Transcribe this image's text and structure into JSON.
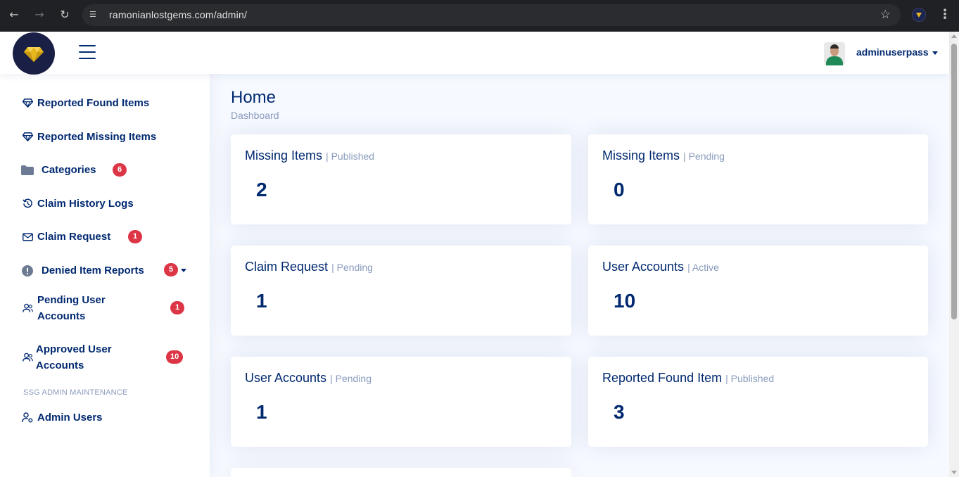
{
  "browser": {
    "url": "ramonianlostgems.com/admin/"
  },
  "header": {
    "user_name": "adminuserpass"
  },
  "sidebar": {
    "items": [
      {
        "label": "Reported Found Items",
        "icon": "gem-icon"
      },
      {
        "label": "Reported Missing Items",
        "icon": "gem-icon"
      },
      {
        "label": "Categories",
        "icon": "folder-icon",
        "badge": "6"
      },
      {
        "label": "Claim History Logs",
        "icon": "history-icon"
      },
      {
        "label": "Claim Request",
        "icon": "envelope-icon",
        "badge": "1"
      },
      {
        "label": "Denied Item Reports",
        "icon": "exclamation-circle-icon",
        "badge": "5"
      },
      {
        "label": "Pending User Accounts",
        "icon": "people-icon",
        "badge": "1"
      },
      {
        "label": "Approved User Accounts",
        "icon": "people-icon",
        "badge": "10"
      }
    ],
    "heading": "SSG ADMIN MAINTENANCE",
    "admin_item": {
      "label": "Admin Users",
      "icon": "person-gear-icon"
    }
  },
  "main": {
    "title": "Home",
    "breadcrumb": "Dashboard",
    "cards": [
      {
        "title": "Missing Items",
        "sub": "| Published",
        "value": "2"
      },
      {
        "title": "Missing Items",
        "sub": "| Pending",
        "value": "0"
      },
      {
        "title": "Claim Request",
        "sub": "| Pending",
        "value": "1"
      },
      {
        "title": "User Accounts",
        "sub": "| Active",
        "value": "10"
      },
      {
        "title": "User Accounts",
        "sub": "| Pending",
        "value": "1"
      },
      {
        "title": "Reported Found Item",
        "sub": "| Published",
        "value": "3"
      }
    ]
  },
  "colors": {
    "primary": "#012970",
    "muted": "#899bbd",
    "badge": "#dc3545",
    "background": "#f6f9ff",
    "logo_bg": "#1a1f45",
    "gem": "#e6b820"
  }
}
